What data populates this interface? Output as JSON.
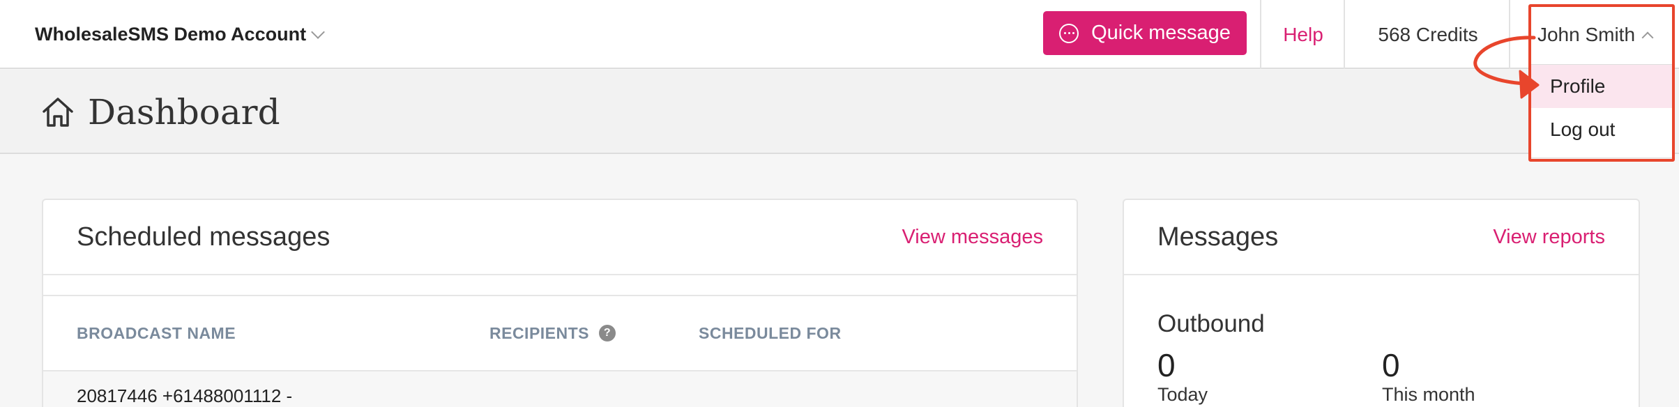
{
  "topbar": {
    "account_name": "WholesaleSMS Demo Account",
    "quick_message_label": "Quick message",
    "help_label": "Help",
    "credits_label": "568 Credits",
    "user_name": "John Smith"
  },
  "user_menu": {
    "items": [
      {
        "label": "Profile"
      },
      {
        "label": "Log out"
      }
    ]
  },
  "page": {
    "title": "Dashboard"
  },
  "scheduled": {
    "title": "Scheduled messages",
    "link": "View messages",
    "columns": [
      "BROADCAST NAME",
      "RECIPIENTS",
      "SCHEDULED FOR"
    ],
    "help_glyph": "?",
    "rows": [
      {
        "broadcast_name": "20817446 +61488001112 -"
      }
    ]
  },
  "messages": {
    "title": "Messages",
    "link": "View reports",
    "outbound_label": "Outbound",
    "today_value": "0",
    "today_label": "Today",
    "month_value": "0",
    "month_label": "This month"
  },
  "colors": {
    "brand": "#d91f72",
    "annotation": "#e8452c",
    "header_text": "#7a8a9c"
  },
  "icons": [
    "chevron-down-icon",
    "chat-bubble-icon",
    "chevron-up-icon",
    "home-icon",
    "help-circle-icon"
  ]
}
